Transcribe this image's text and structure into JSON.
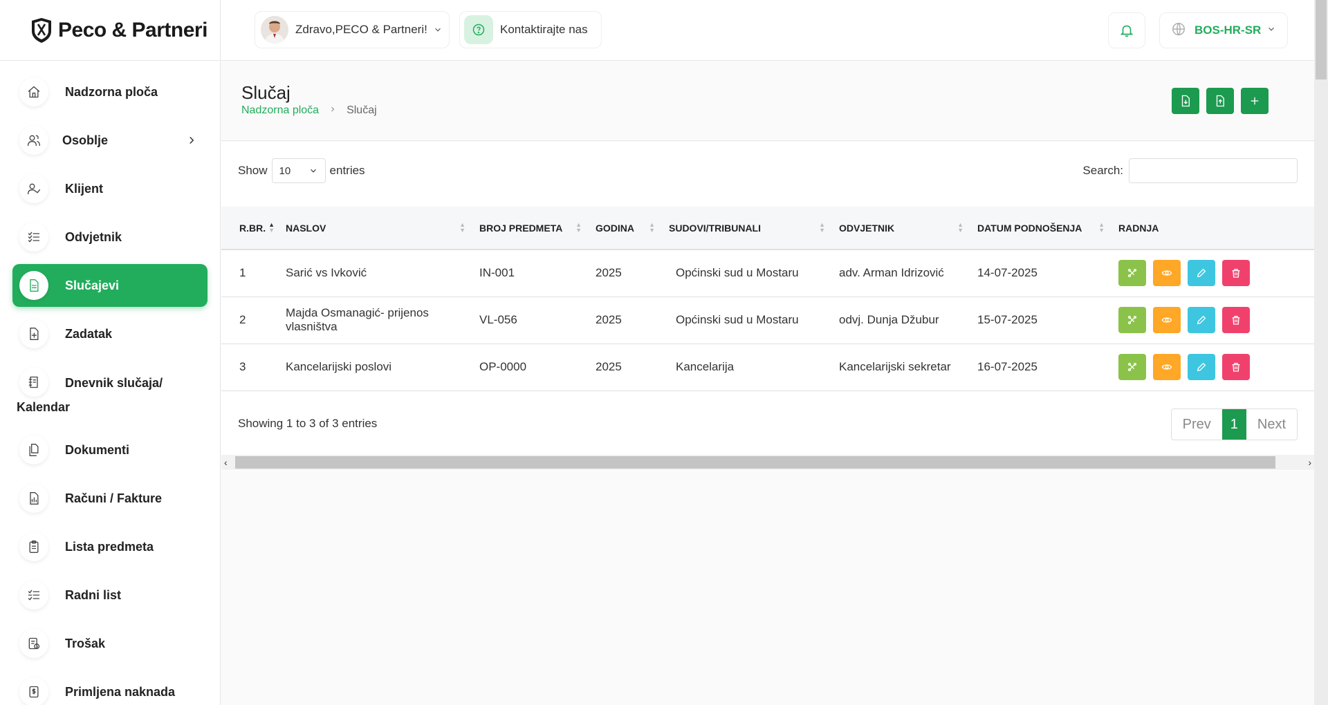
{
  "brand": {
    "name": "Peco & Partneri"
  },
  "topbar": {
    "greeting": "Zdravo,PECO & Partneri!",
    "contact_label": "Kontaktirajte nas",
    "language": "BOS-HR-SR"
  },
  "sidebar": {
    "items": [
      {
        "label": "Nadzorna ploča",
        "icon": "home-icon",
        "active": false
      },
      {
        "label": "Osoblje",
        "icon": "users-icon",
        "active": false,
        "has_chevron": true
      },
      {
        "label": "Klijent",
        "icon": "user-check-icon",
        "active": false
      },
      {
        "label": "Odvjetnik",
        "icon": "list-check-icon",
        "active": false
      },
      {
        "label": "Slučajevi",
        "icon": "document-icon",
        "active": true
      },
      {
        "label": "Zadatak",
        "icon": "file-plus-icon",
        "active": false
      },
      {
        "label_line1": "Dnevnik slučaja/",
        "label_line2": "Kalendar",
        "icon": "notebook-icon",
        "active": false
      },
      {
        "label": "Dokumenti",
        "icon": "copy-icon",
        "active": false
      },
      {
        "label": "Računi / Fakture",
        "icon": "invoice-icon",
        "active": false
      },
      {
        "label": "Lista predmeta",
        "icon": "clipboard-icon",
        "active": false
      },
      {
        "label": "Radni list",
        "icon": "checklist-icon",
        "active": false
      },
      {
        "label": "Trošak",
        "icon": "expense-icon",
        "active": false
      },
      {
        "label": "Primljena naknada",
        "icon": "dollar-icon",
        "active": false
      }
    ]
  },
  "page": {
    "title": "Slučaj",
    "breadcrumb_home": "Nadzorna ploča",
    "breadcrumb_current": "Slučaj"
  },
  "table_controls": {
    "show_label": "Show",
    "entries_value": "10",
    "entries_label": "entries",
    "search_label": "Search:",
    "search_value": ""
  },
  "table": {
    "columns": [
      "R.BR.",
      "NASLOV",
      "BROJ PREDMETA",
      "GODINA",
      "SUDOVI/TRIBUNALI",
      "ODVJETNIK",
      "DATUM PODNOŠENJA",
      "RADNJA"
    ],
    "rows": [
      [
        "1",
        "Sarić vs Ivković",
        "IN-001",
        "2025",
        "Općinski sud u Mostaru",
        "adv. Arman Idrizović",
        "14-07-2025"
      ],
      [
        "2",
        "Majda Osmanagić- prijenos vlasništva",
        "VL-056",
        "2025",
        "Općinski sud u Mostaru",
        "odvj. Dunja Džubur",
        "15-07-2025"
      ],
      [
        "3",
        "Kancelarijski poslovi",
        "OP-0000",
        "2025",
        "Kancelarija",
        "Kancelarijski sekretar",
        "16-07-2025"
      ]
    ]
  },
  "footer": {
    "info": "Showing 1 to 3 of 3 entries",
    "prev": "Prev",
    "page": "1",
    "next": "Next"
  },
  "colors": {
    "accent": "#22ad5c",
    "accent_dark": "#1c9a4f",
    "share": "#8bc34a",
    "view": "#ffa726",
    "edit": "#3ec6e0",
    "delete": "#f0416c"
  }
}
